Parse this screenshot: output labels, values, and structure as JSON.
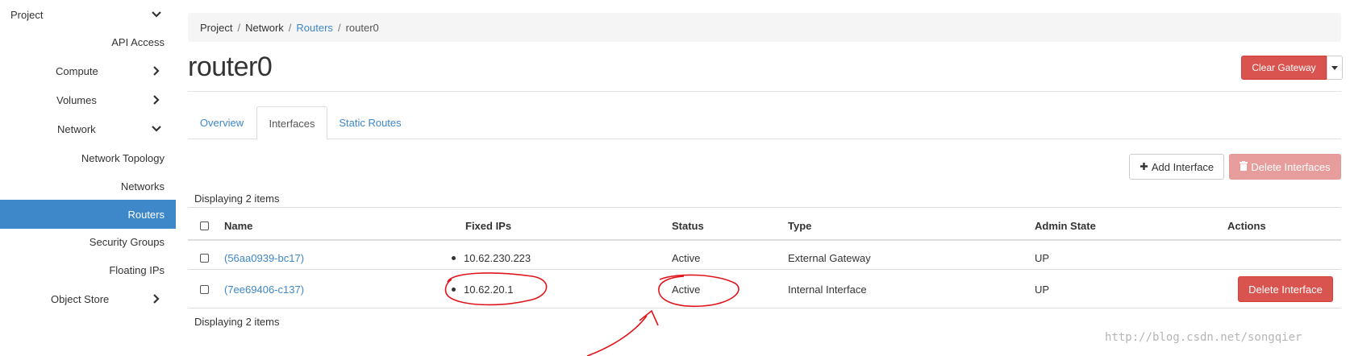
{
  "sidebar": {
    "project": "Project",
    "api_access": "API Access",
    "compute": "Compute",
    "volumes": "Volumes",
    "network": "Network",
    "network_topology": "Network Topology",
    "networks": "Networks",
    "routers": "Routers",
    "security_groups": "Security Groups",
    "floating_ips": "Floating IPs",
    "object_store": "Object Store"
  },
  "breadcrumb": {
    "project": "Project",
    "network": "Network",
    "routers": "Routers",
    "current": "router0",
    "separator": "/"
  },
  "page_title": "router0",
  "header_actions": {
    "clear_gateway": "Clear Gateway"
  },
  "tabs": {
    "overview": "Overview",
    "interfaces": "Interfaces",
    "static_routes": "Static Routes"
  },
  "table_actions": {
    "add_interface": "Add Interface",
    "delete_interfaces": "Delete Interfaces"
  },
  "display_count_top": "Displaying 2 items",
  "display_count_bottom": "Displaying 2 items",
  "columns": {
    "name": "Name",
    "fixed_ips": "Fixed IPs",
    "status": "Status",
    "type": "Type",
    "admin_state": "Admin State",
    "actions": "Actions"
  },
  "rows": [
    {
      "name": "(56aa0939-bc17)",
      "fixed_ip": "10.62.230.223",
      "status": "Active",
      "type": "External Gateway",
      "admin_state": "UP"
    },
    {
      "name": "(7ee69406-c137)",
      "fixed_ip": "10.62.20.1",
      "status": "Active",
      "type": "Internal Interface",
      "admin_state": "UP",
      "action": "Delete Interface"
    }
  ],
  "watermark": "http://blog.csdn.net/songqier",
  "colors": {
    "accent": "#3e87c9",
    "danger": "#d9534f",
    "danger_disabled": "#e79d9b",
    "annotation": "#e0151b"
  },
  "icons": [
    "chevron-down-icon",
    "chevron-right-icon",
    "plus-icon",
    "trash-icon",
    "caret-down-icon"
  ]
}
